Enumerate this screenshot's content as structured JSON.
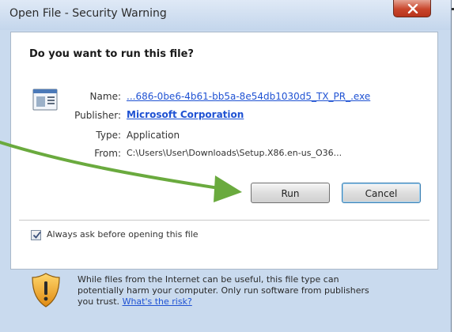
{
  "window": {
    "title": "Open File - Security Warning"
  },
  "dialog": {
    "heading": "Do you want to run this file?",
    "fields": [
      {
        "label": "Name:",
        "value": "...686-0be6-4b61-bb5a-8e54db1030d5_TX_PR_.exe",
        "is_link": true
      },
      {
        "label": "Publisher:",
        "value": "Microsoft Corporation",
        "is_link": true
      },
      {
        "label": "Type:",
        "value": "Application",
        "is_link": false
      },
      {
        "label": "From:",
        "value": "C:\\Users\\User\\Downloads\\Setup.X86.en-us_O36...",
        "is_link": false
      }
    ],
    "buttons": {
      "run": "Run",
      "cancel": "Cancel"
    },
    "checkbox": {
      "label": "Always ask before opening this file",
      "checked": true
    }
  },
  "footer": {
    "line1": "While files from the Internet can be useful, this file type can",
    "line2": "potentially harm your computer. Only run software from publishers",
    "line3_prefix": "you trust.",
    "risk_link": "What's the risk?"
  },
  "colors": {
    "link": "#1f52d3",
    "arrow": "#6aaa3e",
    "close_button": "#c9462c",
    "window_frame": "#c9daee"
  },
  "icons": [
    "close-icon",
    "application-file-icon",
    "checkmark-icon",
    "warning-shield-icon"
  ]
}
